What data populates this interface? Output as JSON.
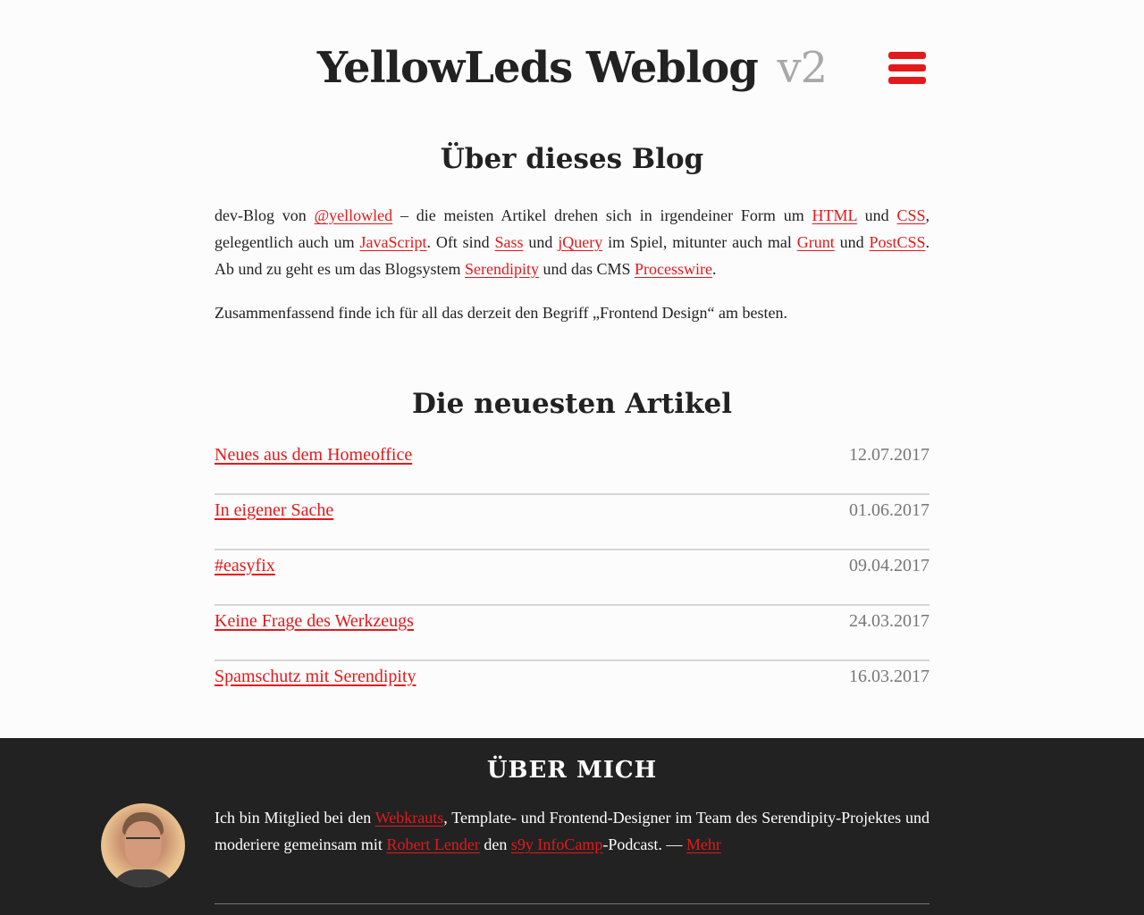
{
  "header": {
    "title": "YellowLeds Weblog",
    "version": "v2",
    "menu_icon": "hamburger-menu-icon",
    "accent_color": "#e3191b"
  },
  "about": {
    "title": "Über dieses Blog",
    "p1": {
      "t1": "dev-Blog von ",
      "link_handle": "@yellowled",
      "t2": " – die meisten Artikel drehen sich in irgendeiner Form um ",
      "link_html": "HTML",
      "t3": " und ",
      "link_css": "CSS",
      "t4": ", gelegentlich auch um ",
      "link_js": "JavaScript",
      "t5": ". Oft sind ",
      "link_sass": "Sass",
      "t6": " und ",
      "link_jquery": "jQuery",
      "t7": " im Spiel, mitunter auch mal ",
      "link_grunt": "Grunt",
      "t8": " und ",
      "link_postcss": "PostCSS",
      "t9": ". Ab und zu geht es um das Blogsystem ",
      "link_serendipity": "Serendipity",
      "t10": " und das CMS ",
      "link_processwire": "Processwire",
      "t11": "."
    },
    "p2": "Zusammenfassend finde ich für all das derzeit den Begriff „Frontend Design“ am besten."
  },
  "articles": {
    "title": "Die neuesten Artikel",
    "items": [
      {
        "title": "Neues aus dem Homeoffice",
        "date": "12.07.2017"
      },
      {
        "title": "In eigener Sache",
        "date": "01.06.2017"
      },
      {
        "title": "#easyfix",
        "date": "09.04.2017"
      },
      {
        "title": "Keine Frage des Werkzeugs",
        "date": "24.03.2017"
      },
      {
        "title": "Spamschutz mit Serendipity",
        "date": "16.03.2017"
      }
    ]
  },
  "footer": {
    "title": "ÜBER MICH",
    "t1": "Ich bin Mitglied bei den ",
    "link_webkrauts": "Webkrauts",
    "t2": ", Template- und Frontend-Designer im Team des Serendipity-Projektes und moderiere gemeinsam mit ",
    "link_lender": "Robert Lender",
    "t3": " den ",
    "link_infocamp": "s9y InfoCamp",
    "t4": "-Podcast. — ",
    "link_more": "Mehr",
    "background_color": "#222222"
  }
}
